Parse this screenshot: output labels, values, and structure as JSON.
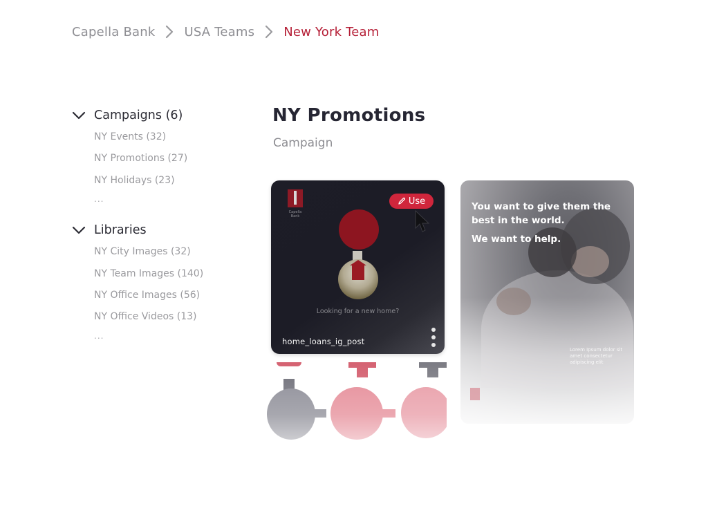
{
  "breadcrumb": [
    {
      "label": "Capella Bank"
    },
    {
      "label": "USA Teams"
    },
    {
      "label": "New York Team"
    }
  ],
  "sidebar": {
    "campaigns": {
      "title": "Campaigns (6)",
      "items": [
        {
          "label": "NY Events (32)"
        },
        {
          "label": "NY Promotions (27)"
        },
        {
          "label": "NY Holidays (23)"
        }
      ],
      "more": "..."
    },
    "libraries": {
      "title": "Libraries",
      "items": [
        {
          "label": "NY City Images (32)"
        },
        {
          "label": "NY Team Images (140)"
        },
        {
          "label": "NY Office Images (56)"
        },
        {
          "label": "NY Office Videos (13)"
        }
      ],
      "more": "..."
    }
  },
  "main": {
    "title": "NY Promotions",
    "subtitle": "Campaign",
    "cards": [
      {
        "name": "home_loans_ig_post",
        "caption": "Looking for a new home?",
        "use_label": "Use",
        "brand_text": "Capella Bank"
      },
      {
        "headline": "You want to give them the best in the world.",
        "subheadline": "We want to help.",
        "body_text": "Lorem Ipsum dolor sit amet consectetur adipiscing elit"
      }
    ]
  },
  "colors": {
    "accent": "#b51e36",
    "use_button": "#d0263c",
    "title": "#262633",
    "muted": "#8e8e93"
  }
}
